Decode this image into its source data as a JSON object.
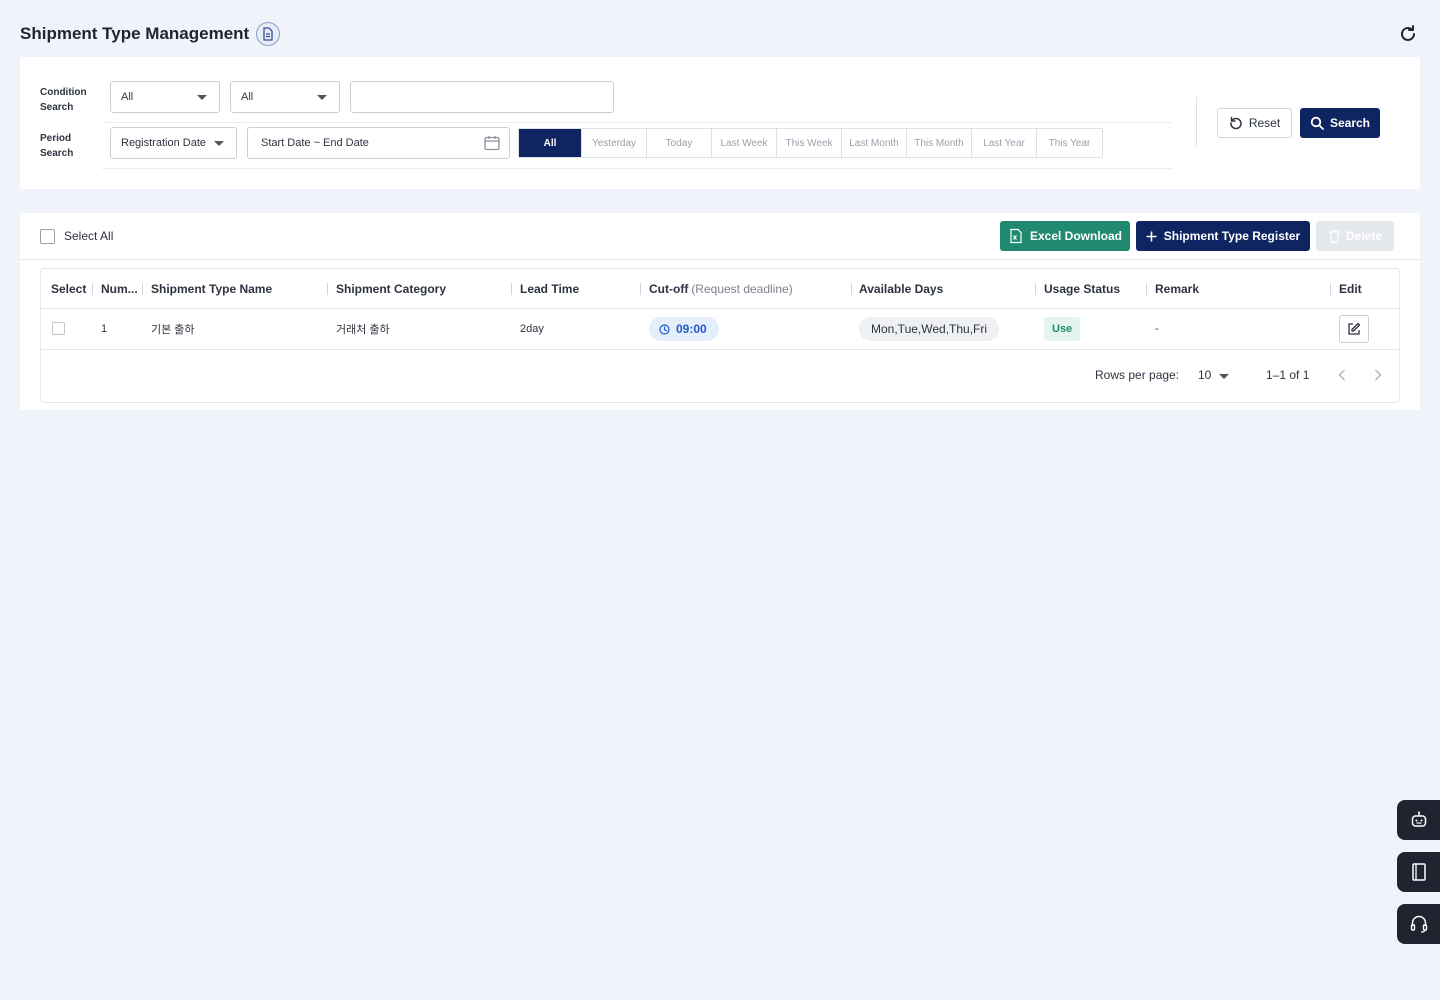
{
  "page": {
    "title": "Shipment Type Management"
  },
  "search": {
    "condition_label_1": "Condition",
    "condition_label_2": "Search",
    "period_label_1": "Period",
    "period_label_2": "Search",
    "condition_select_1": "All",
    "condition_select_2": "All",
    "keyword_value": "",
    "period_field": "Registration Date",
    "date_range_placeholder": "Start Date ~ End Date",
    "period_buttons": [
      "All",
      "Yesterday",
      "Today",
      "Last Week",
      "This Week",
      "Last Month",
      "This Month",
      "Last Year",
      "This Year"
    ],
    "period_selected": "All",
    "reset_label": "Reset",
    "search_label": "Search"
  },
  "toolbar": {
    "select_all_label": "Select All",
    "excel_label": "Excel Download",
    "register_label": "Shipment Type Register",
    "delete_label": "Delete"
  },
  "table": {
    "columns": {
      "select": "Select",
      "num": "Num...",
      "name": "Shipment Type Name",
      "category": "Shipment Category",
      "lead_time": "Lead Time",
      "cutoff": "Cut-off",
      "cutoff_sub": "(Request deadline)",
      "days": "Available Days",
      "status": "Usage Status",
      "remark": "Remark",
      "edit": "Edit"
    },
    "rows": [
      {
        "num": "1",
        "name": "기본 출하",
        "category": "거래처 출하",
        "lead_time": "2day",
        "cutoff": "09:00",
        "days": "Mon,Tue,Wed,Thu,Fri",
        "status": "Use",
        "remark": "-"
      }
    ]
  },
  "pagination": {
    "rows_per_page_label": "Rows per page:",
    "rows_per_page_value": "10",
    "range_text": "1–1 of 1"
  },
  "colors": {
    "primary": "#0f2561",
    "excel": "#1f8a70",
    "chip_blue": "#1f5bc6",
    "status_green": "#1f8a70"
  },
  "icons": [
    "document-icon",
    "refresh-icon",
    "calendar-icon",
    "reset-icon",
    "search-icon",
    "excel-icon",
    "plus-icon",
    "trash-icon",
    "clock-icon",
    "edit-icon",
    "chevron-left-icon",
    "chevron-right-icon",
    "robot-icon",
    "manual-book-icon",
    "headset-icon"
  ]
}
